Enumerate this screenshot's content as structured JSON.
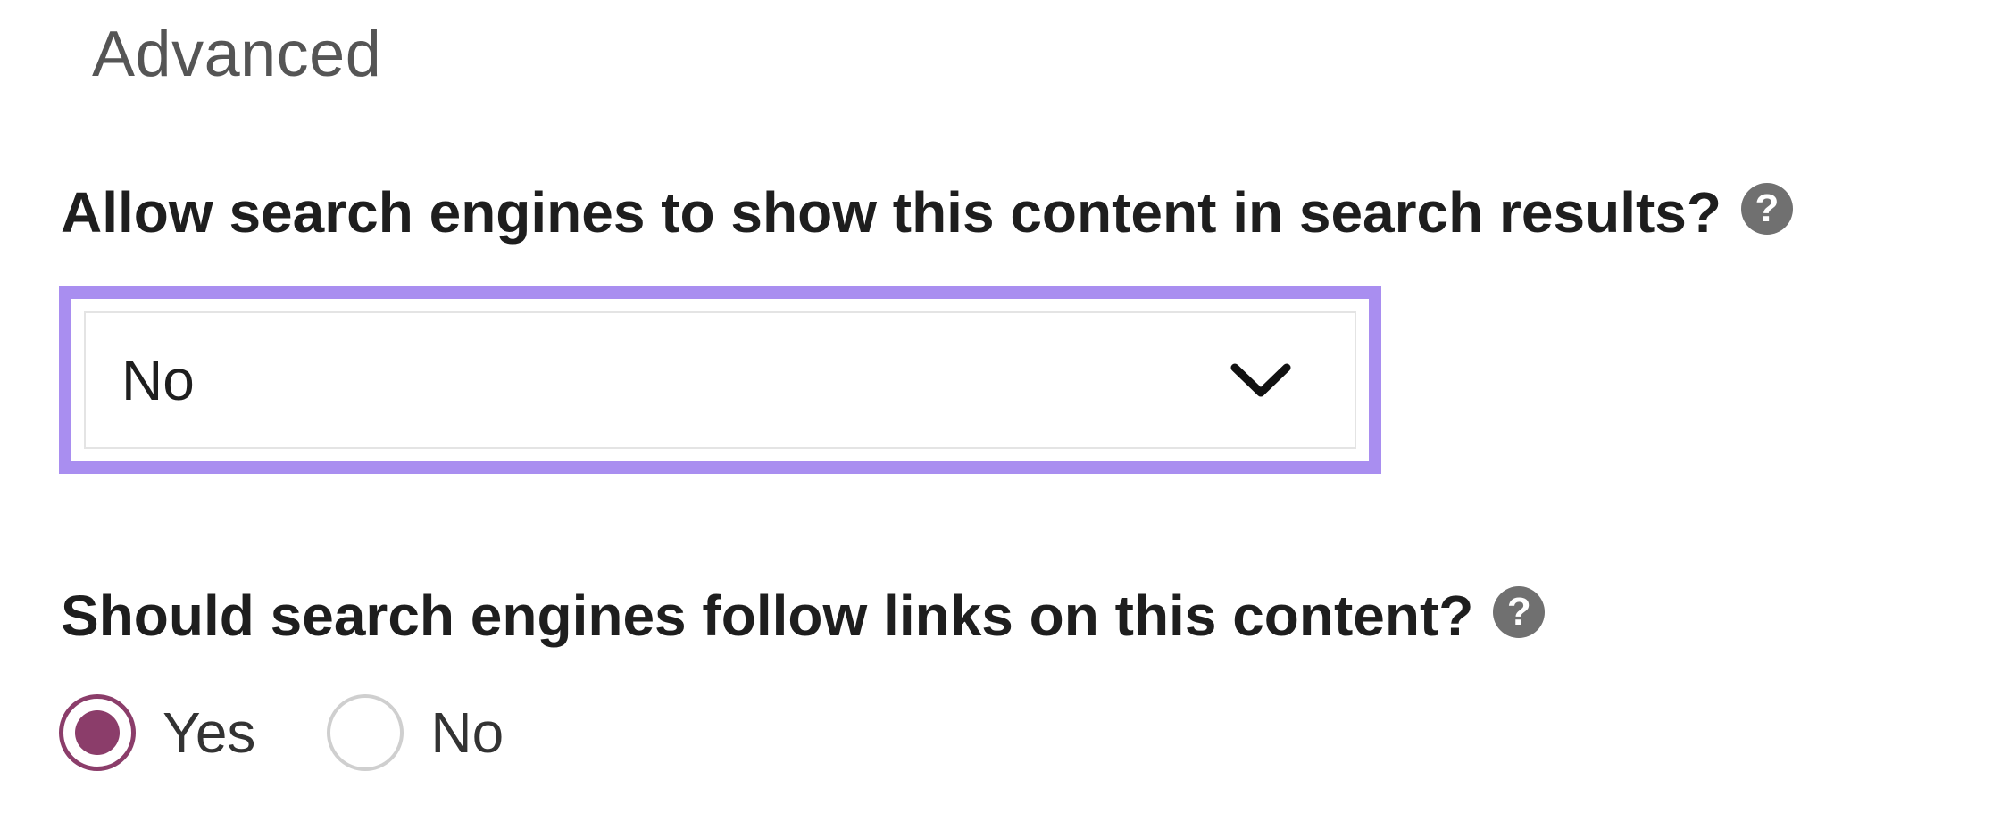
{
  "section": {
    "title": "Advanced"
  },
  "index_setting": {
    "question": "Allow search engines to show this content in search results?",
    "help_glyph": "?",
    "selected_value": "No"
  },
  "follow_setting": {
    "question": "Should search engines follow links on this content?",
    "help_glyph": "?",
    "options": [
      {
        "label": "Yes",
        "checked": true
      },
      {
        "label": "No",
        "checked": false
      }
    ]
  },
  "colors": {
    "focus_ring": "#a98ef0",
    "radio_checked": "#8b3d6a",
    "help_icon_bg": "#707070"
  }
}
